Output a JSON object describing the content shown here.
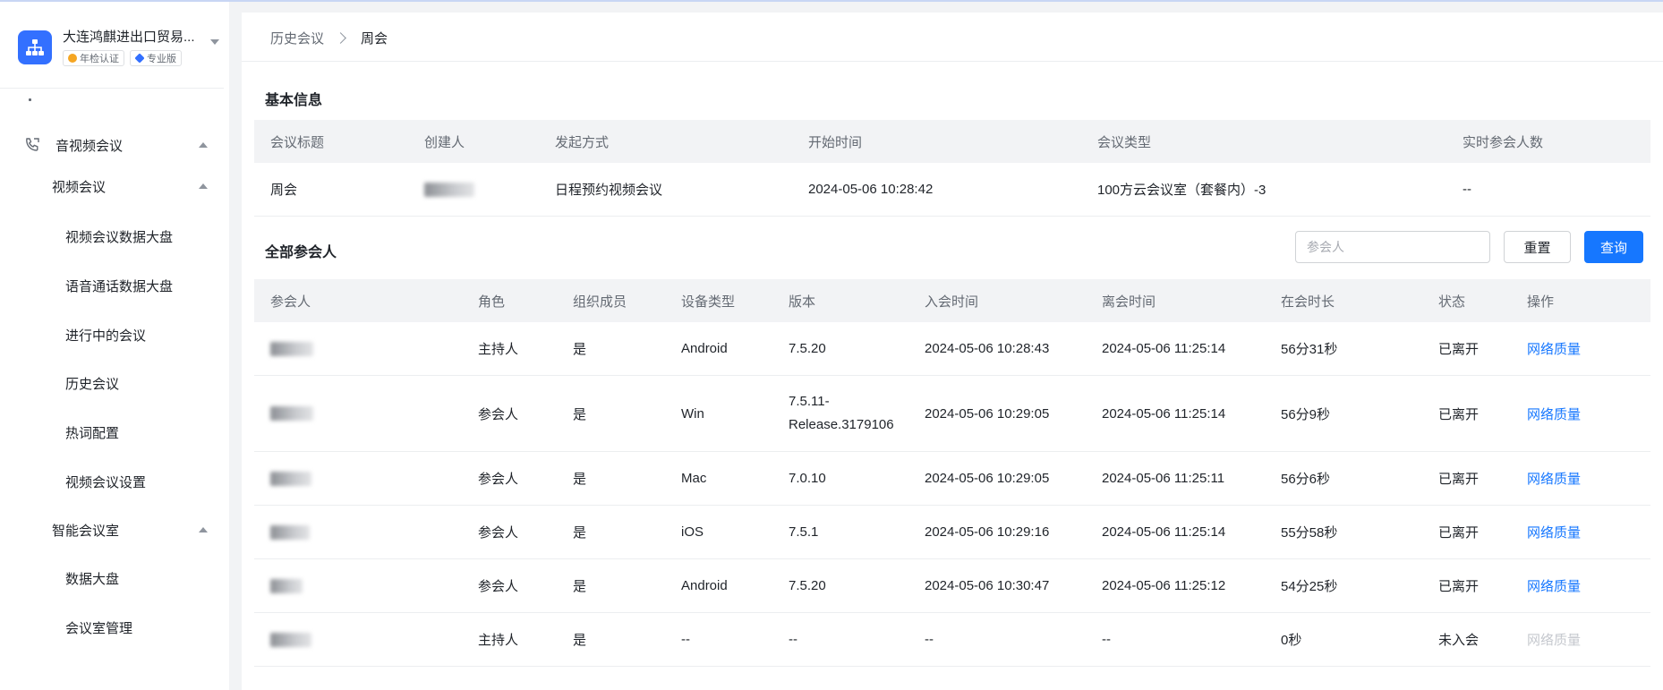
{
  "sidebar": {
    "org_name": "大连鸿麒进出口贸易...",
    "badges": [
      {
        "label": "年检认证",
        "color": "#f5a623"
      },
      {
        "label": "专业版",
        "color": "#3370ff"
      }
    ],
    "menu": {
      "av_meeting": "音视频会议",
      "video_meeting": "视频会议",
      "items_video": [
        "视频会议数据大盘",
        "语音通话数据大盘",
        "进行中的会议",
        "历史会议",
        "热词配置",
        "视频会议设置"
      ],
      "smart_room": "智能会议室",
      "items_room": [
        "数据大盘",
        "会议室管理"
      ]
    }
  },
  "breadcrumb": {
    "prev": "历史会议",
    "current": "周会"
  },
  "basic": {
    "title": "基本信息",
    "headers": [
      "会议标题",
      "创建人",
      "发起方式",
      "开始时间",
      "会议类型",
      "实时参会人数"
    ],
    "values": [
      "周会",
      "",
      "日程预约视频会议",
      "2024-05-06 10:28:42",
      "100方云会议室（套餐内）-3",
      "--"
    ]
  },
  "participants": {
    "title": "全部参会人",
    "search_placeholder": "参会人",
    "reset_label": "重置",
    "query_label": "查询",
    "headers": [
      "参会人",
      "角色",
      "组织成员",
      "设备类型",
      "版本",
      "入会时间",
      "离会时间",
      "在会时长",
      "状态",
      "操作"
    ],
    "rows": [
      {
        "name": "",
        "role": "主持人",
        "member": "是",
        "device": "Android",
        "version": "7.5.20",
        "join": "2024-05-06 10:28:43",
        "leave": "2024-05-06 11:25:14",
        "duration": "56分31秒",
        "status": "已离开",
        "action": "网络质量",
        "action_enabled": true
      },
      {
        "name": "",
        "role": "参会人",
        "member": "是",
        "device": "Win",
        "version": "7.5.11-Release.3179106",
        "join": "2024-05-06 10:29:05",
        "leave": "2024-05-06 11:25:14",
        "duration": "56分9秒",
        "status": "已离开",
        "action": "网络质量",
        "action_enabled": true
      },
      {
        "name": "",
        "role": "参会人",
        "member": "是",
        "device": "Mac",
        "version": "7.0.10",
        "join": "2024-05-06 10:29:05",
        "leave": "2024-05-06 11:25:11",
        "duration": "56分6秒",
        "status": "已离开",
        "action": "网络质量",
        "action_enabled": true
      },
      {
        "name": "",
        "role": "参会人",
        "member": "是",
        "device": "iOS",
        "version": "7.5.1",
        "join": "2024-05-06 10:29:16",
        "leave": "2024-05-06 11:25:14",
        "duration": "55分58秒",
        "status": "已离开",
        "action": "网络质量",
        "action_enabled": true
      },
      {
        "name": "",
        "role": "参会人",
        "member": "是",
        "device": "Android",
        "version": "7.5.20",
        "join": "2024-05-06 10:30:47",
        "leave": "2024-05-06 11:25:12",
        "duration": "54分25秒",
        "status": "已离开",
        "action": "网络质量",
        "action_enabled": true
      },
      {
        "name": "",
        "role": "主持人",
        "member": "是",
        "device": "--",
        "version": "--",
        "join": "--",
        "leave": "--",
        "duration": "0秒",
        "status": "未入会",
        "action": "网络质量",
        "action_enabled": false
      }
    ]
  }
}
